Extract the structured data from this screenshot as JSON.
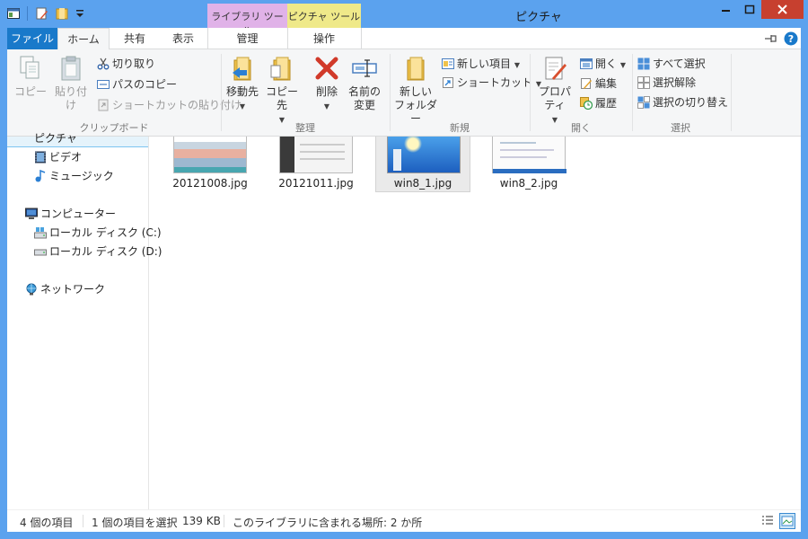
{
  "window": {
    "title": "ピクチャ",
    "context_tabs": {
      "library_tools": "ライブラリ ツール",
      "picture_tools": "ピクチャ ツール"
    }
  },
  "tabs": {
    "file": "ファイル",
    "home": "ホーム",
    "share": "共有",
    "view": "表示",
    "manage": "管理",
    "operation": "操作"
  },
  "ribbon": {
    "clipboard": {
      "group_label": "クリップボード",
      "copy": "コピー",
      "paste": "貼り付け",
      "cut": "切り取り",
      "copy_path": "パスのコピー",
      "paste_shortcut": "ショートカットの貼り付け"
    },
    "organize": {
      "group_label": "整理",
      "move_to": "移動先",
      "copy_to": "コピー先",
      "delete": "削除",
      "rename_line1": "名前の",
      "rename_line2": "変更"
    },
    "new": {
      "group_label": "新規",
      "new_folder_line1": "新しい",
      "new_folder_line2": "フォルダー",
      "new_item": "新しい項目",
      "shortcut": "ショートカット"
    },
    "open": {
      "group_label": "開く",
      "properties": "プロパティ",
      "open": "開く",
      "edit": "編集",
      "history": "履歴"
    },
    "select": {
      "group_label": "選択",
      "select_all": "すべて選択",
      "select_none": "選択解除",
      "invert": "選択の切り替え"
    }
  },
  "nav": {
    "partial_item": "ピクチャ",
    "video": "ビデオ",
    "music": "ミュージック",
    "computer": "コンピューター",
    "disk_c": "ローカル ディスク (C:)",
    "disk_d": "ローカル ディスク (D:)",
    "network": "ネットワーク"
  },
  "files": [
    {
      "name": "20121008.jpg",
      "selected": false
    },
    {
      "name": "20121011.jpg",
      "selected": false
    },
    {
      "name": "win8_1.jpg",
      "selected": true
    },
    {
      "name": "win8_2.jpg",
      "selected": false
    }
  ],
  "status": {
    "item_count": "4 個の項目",
    "selection": "1 個の項目を選択",
    "size": "139 KB",
    "locations": "このライブラリに含まれる場所: 2 か所"
  },
  "colors": {
    "frame": "#5ba2ee",
    "file_tab": "#1979ca",
    "library_tools": "#e0b2e8",
    "picture_tools": "#efe989",
    "close_button": "#c7402f",
    "selection": "#eaeaea"
  }
}
